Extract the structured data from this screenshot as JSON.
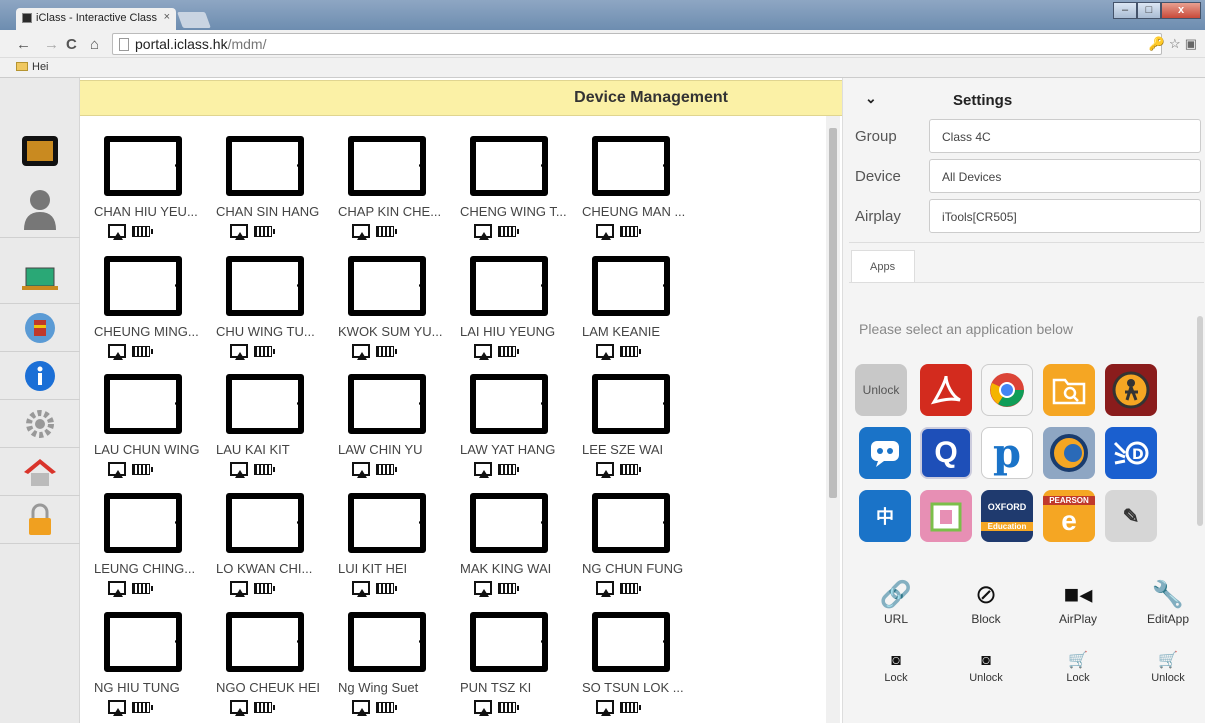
{
  "browser": {
    "tab_title": "iClass - Interactive Class",
    "tab_close": "×",
    "url_host": "portal.iclass.hk",
    "url_path": "/mdm/",
    "bookmark": "Hei"
  },
  "header": {
    "title": "Device Management"
  },
  "devices": [
    "CHAN HIU YEU...",
    "CHAN SIN HANG",
    "CHAP KIN CHE...",
    "CHENG WING T...",
    "CHEUNG MAN ...",
    "CHEUNG MING...",
    "CHU WING TU...",
    "KWOK SUM YU...",
    "LAI HIU YEUNG",
    "LAM KEANIE",
    "LAU CHUN WING",
    "LAU KAI KIT",
    "LAW CHIN YU",
    "LAW YAT HANG",
    "LEE SZE WAI",
    "LEUNG CHING...",
    "LO KWAN CHI...",
    "LUI KIT HEI",
    "MAK KING WAI",
    "NG CHUN FUNG",
    "NG HIU TUNG",
    "NGO CHEUK HEI",
    "Ng Wing Suet",
    "PUN TSZ KI",
    "SO TSUN LOK ..."
  ],
  "settings": {
    "title": "Settings",
    "group_label": "Group",
    "group_value": "Class 4C",
    "device_label": "Device",
    "device_value": "All Devices",
    "airplay_label": "Airplay",
    "airplay_value": "iTools[CR505]",
    "apps_tab": "Apps",
    "hint": "Please select an application below",
    "unlock_tile": "Unlock"
  },
  "actions": {
    "url": "URL",
    "block": "Block",
    "airplay": "AirPlay",
    "editapp": "EditApp",
    "lock1": "Lock",
    "unlock1": "Unlock",
    "lock2": "Lock",
    "unlock2": "Unlock"
  },
  "colors": {
    "header_bg": "#fbf1a6",
    "accent": "#1b5fb8"
  }
}
